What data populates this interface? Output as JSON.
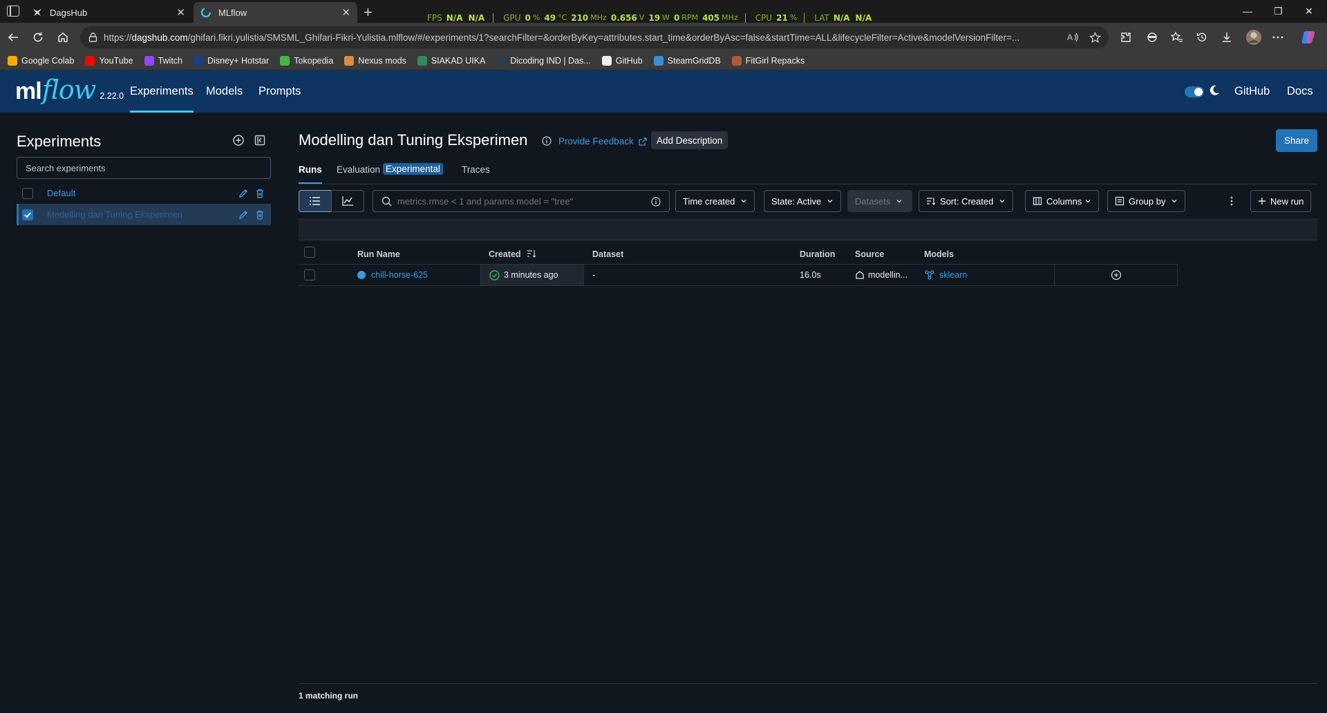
{
  "browser": {
    "tabs": [
      {
        "title": "DagsHub",
        "icon": "dagshub-favicon"
      },
      {
        "title": "MLflow",
        "icon": "mlflow-favicon"
      }
    ],
    "overlay": {
      "fps_label": "FPS",
      "fps_val1": "N/A",
      "fps_val2": "N/A",
      "gpu_label": "GPU",
      "gpu_util": "0",
      "gpu_util_unit": "%",
      "gpu_temp": "49",
      "gpu_temp_unit": "°C",
      "gpu_clock": "210",
      "gpu_clock_unit": "MHz",
      "gpu_volt": "0.656",
      "gpu_volt_unit": "V",
      "gpu_power": "19",
      "gpu_power_unit": "W",
      "gpu_fan": "0",
      "gpu_fan_unit": "RPM",
      "gpu_mem": "405",
      "gpu_mem_unit": "MHz",
      "cpu_label": "CPU",
      "cpu_util": "21",
      "cpu_util_unit": "%",
      "lat_label": "LAT",
      "lat_val1": "N/A",
      "lat_val2": "N/A"
    },
    "url_prefix": "https://",
    "url_host": "dagshub.com",
    "url_rest": "/ghifari.fikri.yulistia/SMSML_Ghifari-Fikri-Yulistia.mlflow/#/experiments/1?searchFilter=&orderByKey=attributes.start_time&orderByAsc=false&startTime=ALL&lifecycleFilter=Active&modelVersionFilter=...",
    "bookmarks": [
      {
        "label": "Google Colab",
        "color": "#f9ab00"
      },
      {
        "label": "YouTube",
        "color": "#ff0000"
      },
      {
        "label": "Twitch",
        "color": "#9146ff"
      },
      {
        "label": "Disney+ Hotstar",
        "color": "#1f3c88"
      },
      {
        "label": "Tokopedia",
        "color": "#42b549"
      },
      {
        "label": "Nexus mods",
        "color": "#d98f40"
      },
      {
        "label": "SIAKAD UIKA",
        "color": "#2e8b57"
      },
      {
        "label": "Dicoding IND | Das...",
        "color": "#2d3e50"
      },
      {
        "label": "GitHub",
        "color": "#f0f0f0"
      },
      {
        "label": "SteamGridDB",
        "color": "#3a8fd9"
      },
      {
        "label": "FitGirl Repacks",
        "color": "#b05a3c"
      }
    ]
  },
  "header": {
    "logo_ml": "ml",
    "logo_flow": "flow",
    "version": "2.22.0",
    "nav": [
      "Experiments",
      "Models",
      "Prompts"
    ],
    "right_links": [
      "GitHub",
      "Docs"
    ]
  },
  "sidebar": {
    "title": "Experiments",
    "search_placeholder": "Search experiments",
    "items": [
      {
        "name": "Default",
        "checked": false
      },
      {
        "name": "Modelling dan Tuning Eksperimen",
        "checked": true
      }
    ]
  },
  "main": {
    "title": "Modelling dan Tuning Eksperimen",
    "feedback": "Provide Feedback",
    "add_description": "Add Description",
    "share": "Share",
    "tabs": [
      "Runs",
      "Evaluation",
      "Traces"
    ],
    "experimental_badge": "Experimental",
    "search_placeholder": "metrics.rmse < 1 and params.model = \"tree\"",
    "toolbar": {
      "time_created": "Time created",
      "state": "State: Active",
      "datasets": "Datasets",
      "sort": "Sort: Created",
      "columns": "Columns",
      "group_by": "Group by",
      "new_run": "New run"
    },
    "columns": [
      "Run Name",
      "Created",
      "Dataset",
      "Duration",
      "Source",
      "Models"
    ],
    "runs": [
      {
        "run_name": "chill-horse-625",
        "color": "#4299e0",
        "created": "3 minutes ago",
        "dataset": "-",
        "duration": "16.0s",
        "source": "modellin...",
        "models": "sklearn"
      }
    ],
    "footer": "1 matching run"
  }
}
